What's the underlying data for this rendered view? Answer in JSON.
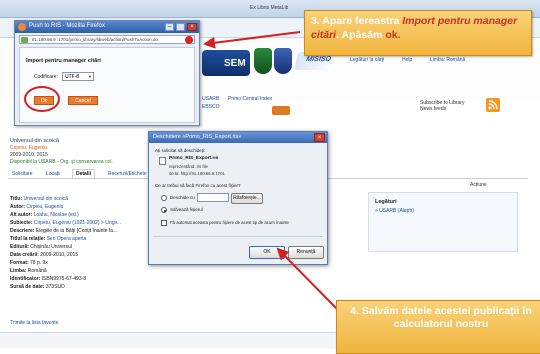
{
  "browser": {
    "tab_title": "Ex Libris MetaLib",
    "header_links": [
      "Legături la cărți",
      "Help",
      "Limba: Română"
    ],
    "nav_items": [
      "USARB",
      "Primo Central Index"
    ],
    "ebsco_label": "EBSCO",
    "subscribe_label": "Subscribe to Library News feeds",
    "record": {
      "institution": "Universul din scoică",
      "author_line": "Cirpeiu, Eugeniu",
      "years": "2009-2010, 2015",
      "availability": "Disponibil la USARB - Org. și conservarea col.",
      "tabs": [
        "Solicitare",
        "Locații",
        "Detalii",
        "Recenzii/Etichete"
      ],
      "actions_header": "Acțiune",
      "links_title": "Legături",
      "links_item": "» USARB (Aleph)",
      "fields": [
        {
          "label": "Titlu:",
          "value": "Universul din scoică"
        },
        {
          "label": "Autor:",
          "value": "Cirpeiu, Eugeniu"
        },
        {
          "label": "Alt autor:",
          "value": "Loahu, Nicolae (ed.)"
        },
        {
          "label": "Subiecte:",
          "value": "Cirpeiu, Eugeniu (1921-2002) > Lingv..."
        },
        {
          "label": "Descriere:",
          "value": "Elegiile de la Bălți [Conțit înainte la..."
        },
        {
          "label": "Titlul la relație:",
          "value": "Seri Opera aperta"
        },
        {
          "label": "Editură:",
          "value": "Chișinău Universul"
        },
        {
          "label": "Data creării:",
          "value": "2009-2010, 2015"
        },
        {
          "label": "Format:",
          "value": "78 p. 9x"
        },
        {
          "label": "Limba:",
          "value": "Română"
        },
        {
          "label": "Identificator:",
          "value": "ISBN9975-67-493-8"
        },
        {
          "label": "Sursă de date:",
          "value": "373SUD"
        }
      ],
      "footer_link": "Trimite la lista favorite"
    }
  },
  "popup": {
    "title": "Push to RIS - Mozilla Firefox",
    "url": "81.180.66.9 :1701/primo_library/libweb/action/PushToAction.do",
    "heading": "Import pentru manager citări",
    "encoding_label": "Codificare:",
    "encoding_value": "UTF-8",
    "ok_label": "Ok",
    "cancel_label": "Cancel"
  },
  "dialog": {
    "title": "Deschidere «Primo_RIS_Export.ris»",
    "intro": "Ați solicitat să deschideți:",
    "filename": "Primo_RIS_Export.ris",
    "filetype": "reprezentând: ris file",
    "from": "de la: http://81.180.66.9:1701",
    "question": "Ce ar trebui să facă Firefox cu acest fișier?",
    "open_with_label": "Deschide cu",
    "browse_label": "Răsfoiește...",
    "save_label": "Salvează fișierul",
    "auto_label": "Fă automat aceasta pentru fișiere de acest tip de acum înainte",
    "ok_label": "OK",
    "cancel_label": "Renunță"
  },
  "callouts": {
    "step3_prefix": "3. Apare fereastra ",
    "step3_italic": "Import pentru manager citări",
    "step3_suffix": ". Apăsăm ",
    "step3_ok": "ok.",
    "step4": "4. Salvăm datele acestei publicații în calculatorul nostru"
  },
  "colors": {
    "callout": "#f3bd4f",
    "ok_button": "#f07a2a",
    "highlight_ring": "#d42020",
    "arrow": "#d42020",
    "title_bar": "#3a6ab8"
  }
}
